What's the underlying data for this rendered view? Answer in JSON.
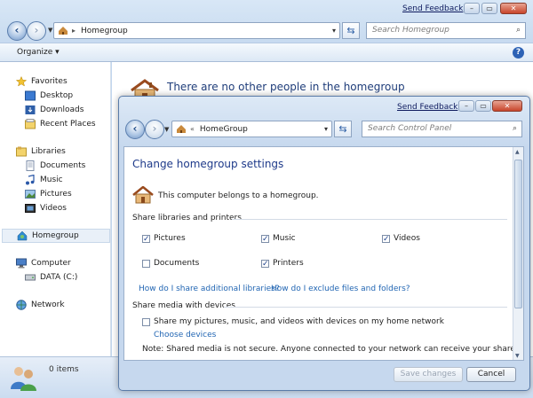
{
  "back_window": {
    "send_feedback": "Send Feedback",
    "address": {
      "path": "Homegroup"
    },
    "search_placeholder": "Search Homegroup",
    "toolbar": {
      "organize": "Organize ▾",
      "help": "?"
    },
    "nav": {
      "favorites": "Favorites",
      "favorites_items": [
        "Desktop",
        "Downloads",
        "Recent Places"
      ],
      "libraries": "Libraries",
      "libraries_items": [
        "Documents",
        "Music",
        "Pictures",
        "Videos"
      ],
      "homegroup": "Homegroup",
      "computer": "Computer",
      "computer_items": [
        "DATA (C:)"
      ],
      "network": "Network"
    },
    "content_message": "There are no other people in the homegroup",
    "details": {
      "items": "0 items"
    }
  },
  "front_window": {
    "send_feedback": "Send Feedback",
    "address": {
      "prefix": "«",
      "path": "HomeGroup"
    },
    "search_placeholder": "Search Control Panel",
    "title": "Change homegroup settings",
    "belongs": "This computer belongs to a homegroup.",
    "share_libraries_heading": "Share libraries and printers",
    "options": {
      "pictures": {
        "label": "Pictures",
        "checked": true
      },
      "music": {
        "label": "Music",
        "checked": true
      },
      "videos": {
        "label": "Videos",
        "checked": true
      },
      "documents": {
        "label": "Documents",
        "checked": false
      },
      "printers": {
        "label": "Printers",
        "checked": true
      }
    },
    "links": {
      "share_additional": "How do I share additional libraries?",
      "exclude": "How do I exclude files and folders?",
      "choose_devices": "Choose devices"
    },
    "share_media_heading": "Share media with devices",
    "share_media_option": {
      "label": "Share my pictures, music, and videos with devices on my home network",
      "checked": false
    },
    "note": "Note: Shared media is not secure. Anyone connected to your network can receive your shared media.",
    "buttons": {
      "save": "Save changes",
      "cancel": "Cancel"
    }
  },
  "colors": {
    "title_blue": "#1e3a8a",
    "link_blue": "#2266b3",
    "window_frame": "#c3d7ee"
  }
}
